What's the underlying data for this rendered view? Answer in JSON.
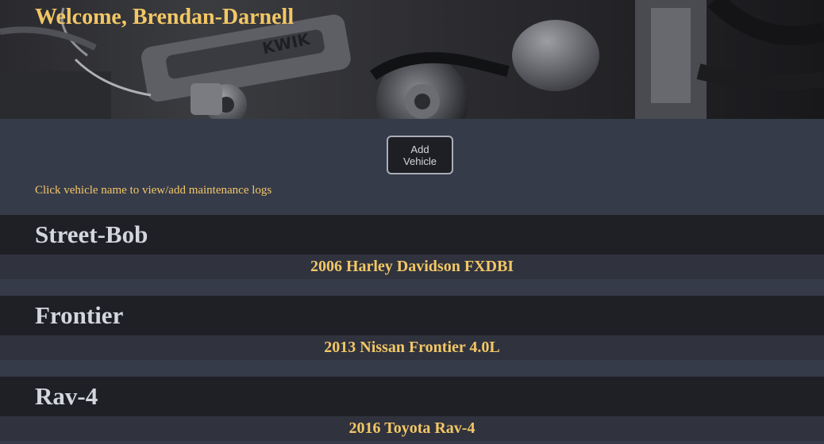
{
  "header": {
    "welcome_prefix": "Welcome, ",
    "username": "Brendan-Darnell",
    "background_image": "engine-bay-photo"
  },
  "controls": {
    "add_vehicle_label": "Add Vehicle",
    "hint": "Click vehicle name to view/add maintenance logs"
  },
  "vehicles": [
    {
      "name": "Street-Bob",
      "description": "2006 Harley Davidson FXDBI"
    },
    {
      "name": "Frontier",
      "description": "2013 Nissan Frontier 4.0L"
    },
    {
      "name": "Rav-4",
      "description": "2016 Toyota Rav-4"
    }
  ],
  "colors": {
    "accent_gold": "#f3c766",
    "page_bg": "#363b4a",
    "name_bar": "#1f2026",
    "desc_bar": "#30333e",
    "name_text": "#d3d6dd"
  }
}
